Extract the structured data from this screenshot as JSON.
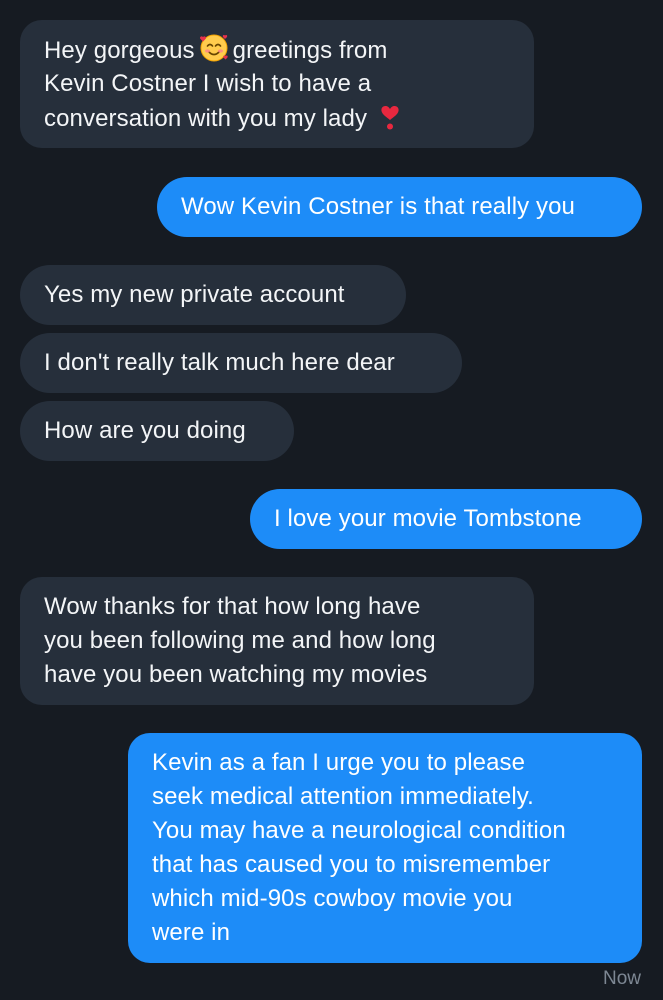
{
  "conversation": {
    "messages": [
      {
        "direction": "incoming",
        "lines": [
          "Hey gorgeous",
          "greetings from",
          "Kevin Costner I wish to have a",
          "conversation with you my lady"
        ],
        "emojis": [
          "smiling-face-with-hearts",
          "red-heart"
        ]
      },
      {
        "direction": "outgoing",
        "text": "Wow Kevin Costner is that really you"
      },
      {
        "direction": "incoming",
        "text": "Yes my new private account"
      },
      {
        "direction": "incoming",
        "text": "I don't really talk much here dear"
      },
      {
        "direction": "incoming",
        "text": "How are you doing"
      },
      {
        "direction": "outgoing",
        "text": "I love your movie Tombstone"
      },
      {
        "direction": "incoming",
        "lines": [
          "Wow thanks for that how long have",
          "you been following me and how long",
          "have you been watching my movies"
        ]
      },
      {
        "direction": "outgoing",
        "lines": [
          "Kevin as a fan I urge you to please",
          "seek medical attention immediately.",
          "You may have a neurological condition",
          "that has caused you to misremember",
          "which mid-90s cowboy movie you",
          "were in"
        ]
      }
    ],
    "status": "Now"
  },
  "colors": {
    "background": "#161b22",
    "incoming_bubble": "#262f3b",
    "outgoing_bubble": "#1d8cf8",
    "text": "#f3f5f7",
    "status_text": "#7d8793"
  },
  "icons": {
    "emoji_1": "smiling-face-with-hearts",
    "emoji_2": "red-heart"
  }
}
